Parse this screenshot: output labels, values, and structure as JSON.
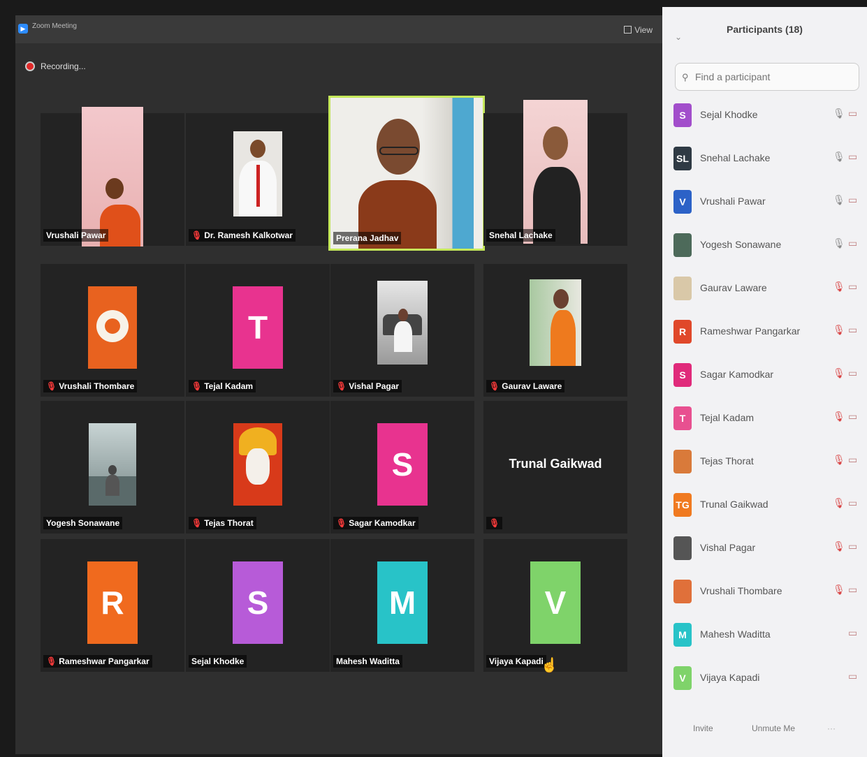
{
  "window": {
    "title": "Zoom Meeting",
    "view_label": "View",
    "recording_label": "Recording..."
  },
  "tiles": [
    {
      "name": "Vrushali Pawar",
      "muted": false
    },
    {
      "name": "Dr. Ramesh Kalkotwar",
      "muted": true
    },
    {
      "name": "Prerana Jadhav",
      "muted": false
    },
    {
      "name": "Snehal Lachake",
      "muted": false
    },
    {
      "name": "Vrushali Thombare",
      "muted": true
    },
    {
      "name": "Tejal Kadam",
      "muted": true,
      "initial": "T",
      "color": "#e8338f"
    },
    {
      "name": "Vishal Pagar",
      "muted": true
    },
    {
      "name": "Gaurav Laware",
      "muted": true
    },
    {
      "name": "Yogesh Sonawane",
      "muted": false
    },
    {
      "name": "Tejas Thorat",
      "muted": true
    },
    {
      "name": "Sagar Kamodkar",
      "muted": true,
      "initial": "S",
      "color": "#e8338f"
    },
    {
      "name": "Trunal Gaikwad",
      "muted": true
    },
    {
      "name": "Rameshwar Pangarkar",
      "muted": true,
      "initial": "R",
      "color": "#f06a1e"
    },
    {
      "name": "Sejal Khodke",
      "muted": false,
      "initial": "S",
      "color": "#b75bd8"
    },
    {
      "name": "Mahesh Waditta",
      "muted": false,
      "initial": "M",
      "color": "#28c3c8"
    },
    {
      "name": "Vijaya Kapadi",
      "muted": false,
      "initial": "V",
      "color": "#7fd36a"
    }
  ],
  "panel": {
    "title": "Participants (18)",
    "search_placeholder": "Find a participant",
    "participants": [
      {
        "name": "Sejal Khodke",
        "avatar": "S",
        "color": "#a24ecb",
        "mic_muted": false
      },
      {
        "name": "Snehal Lachake",
        "avatar": "SL",
        "color": "#2f3a44",
        "mic_muted": false
      },
      {
        "name": "Vrushali Pawar",
        "avatar": "V",
        "color": "#2c62c7",
        "mic_muted": false
      },
      {
        "name": "Yogesh Sonawane",
        "avatar": "",
        "color": "#4d6a5a",
        "mic_muted": false
      },
      {
        "name": "Gaurav Laware",
        "avatar": "",
        "color": "#d9c8a8",
        "mic_muted": true
      },
      {
        "name": "Rameshwar Pangarkar",
        "avatar": "R",
        "color": "#e0482a",
        "mic_muted": true
      },
      {
        "name": "Sagar Kamodkar",
        "avatar": "S",
        "color": "#e02a7a",
        "mic_muted": true
      },
      {
        "name": "Tejal Kadam",
        "avatar": "T",
        "color": "#e85090",
        "mic_muted": true
      },
      {
        "name": "Tejas Thorat",
        "avatar": "",
        "color": "#d97a3a",
        "mic_muted": true
      },
      {
        "name": "Trunal Gaikwad",
        "avatar": "TG",
        "color": "#f07a20",
        "mic_muted": true
      },
      {
        "name": "Vishal Pagar",
        "avatar": "",
        "color": "#555555",
        "mic_muted": true
      },
      {
        "name": "Vrushali Thombare",
        "avatar": "",
        "color": "#e0703a",
        "mic_muted": true
      },
      {
        "name": "Mahesh Waditta",
        "avatar": "M",
        "color": "#28c3c8",
        "mic_muted": false
      },
      {
        "name": "Vijaya Kapadi",
        "avatar": "V",
        "color": "#7fd36a",
        "mic_muted": false
      }
    ],
    "footer": {
      "invite": "Invite",
      "unmute_me": "Unmute Me"
    }
  }
}
